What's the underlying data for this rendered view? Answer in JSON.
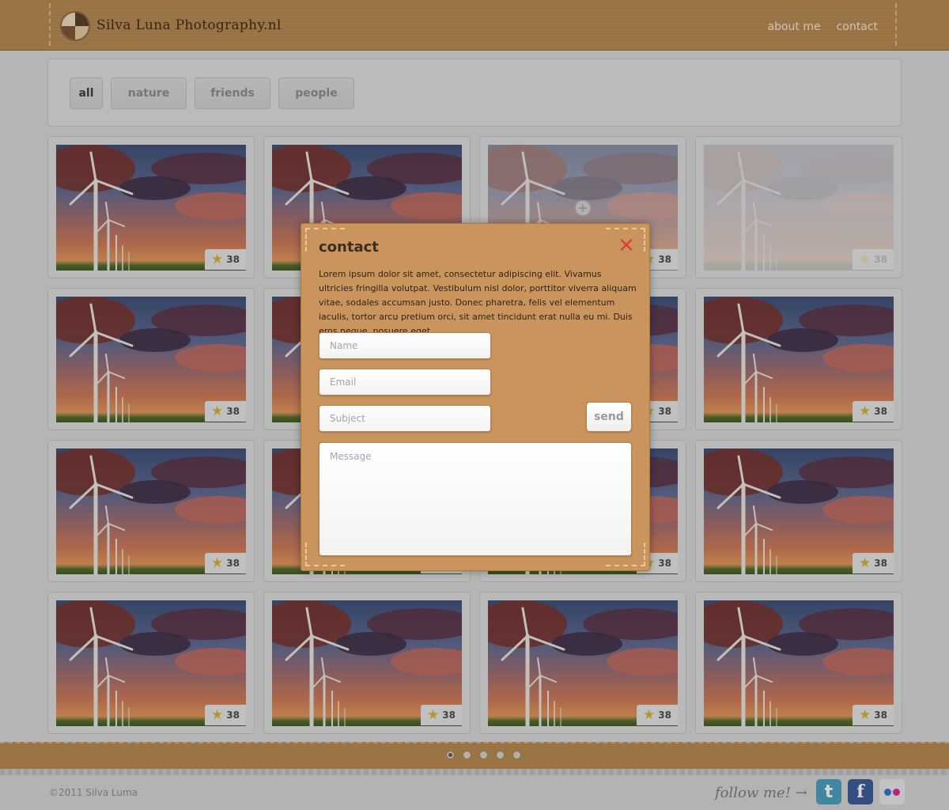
{
  "header": {
    "logo_text": "Silva Luna Photography.nl",
    "nav": [
      {
        "label": "about me"
      },
      {
        "label": "contact"
      }
    ]
  },
  "filters": [
    {
      "label": "all",
      "active": true
    },
    {
      "label": "nature",
      "active": false
    },
    {
      "label": "friends",
      "active": false
    },
    {
      "label": "people",
      "active": false
    }
  ],
  "gallery": {
    "star_count": "38"
  },
  "modal": {
    "title": "contact",
    "close_symbol": "✕",
    "body": "Lorem ipsum dolor sit amet, consectetur adipiscing elit. Vivamus ultricies fringilla volutpat. Vestibulum nisl dolor, porttitor viverra aliquam vitae, sodales accumsan justo. Donec pharetra, felis vel elementum iaculis, tortor arcu pretium orci, sit amet tincidunt erat nulla eu mi. Duis eros neque, posuere eget.",
    "name_placeholder": "Name",
    "email_placeholder": "Email",
    "subject_placeholder": "Subject",
    "message_placeholder": "Message",
    "send_label": "send"
  },
  "pager": {
    "pages": 5,
    "active": 0
  },
  "footer": {
    "copyright": "©2011 Silva Luma",
    "follow": "follow me! →",
    "social": [
      "twitter-icon",
      "facebook-icon",
      "flickr-icon"
    ]
  }
}
